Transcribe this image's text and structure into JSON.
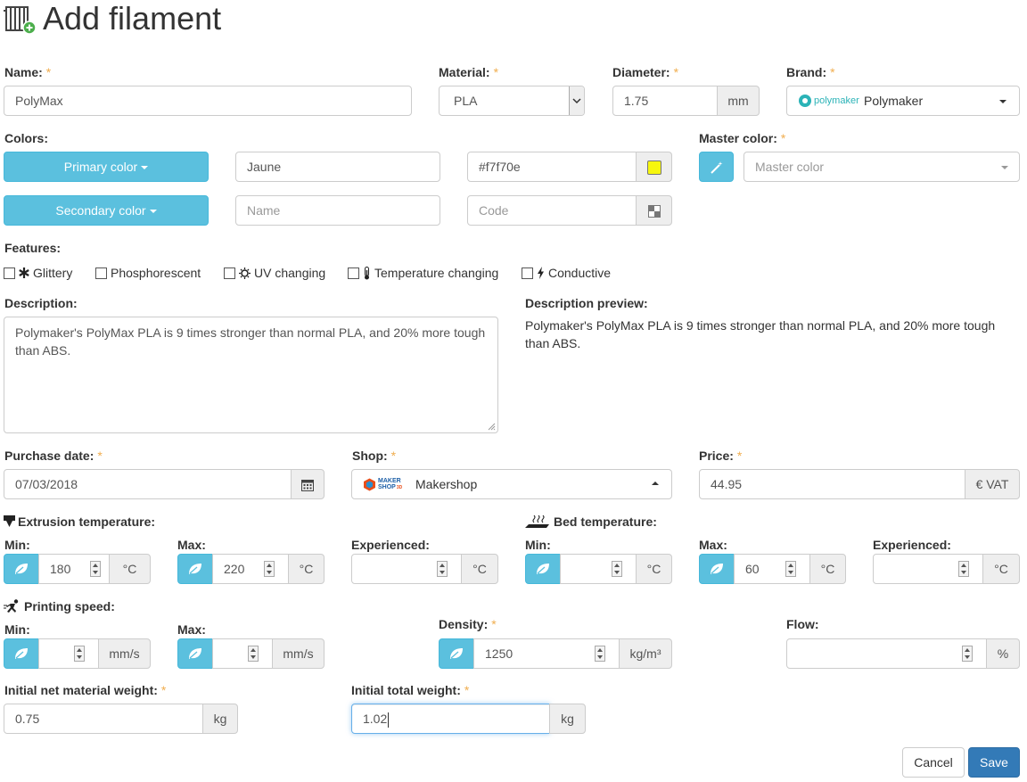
{
  "page": {
    "title": "Add filament"
  },
  "form": {
    "name": {
      "label": "Name:",
      "required": "*",
      "value": "PolyMax"
    },
    "material": {
      "label": "Material:",
      "required": "*",
      "value": "PLA"
    },
    "diameter": {
      "label": "Diameter:",
      "required": "*",
      "value": "1.75",
      "unit": "mm"
    },
    "brand": {
      "label": "Brand:",
      "required": "*",
      "logo_text": "polymaker",
      "value": "Polymaker"
    },
    "colors": {
      "label": "Colors:",
      "primary": {
        "button": "Primary color",
        "name": "Jaune",
        "code": "#f7f70e",
        "swatch": "#f7f70e"
      },
      "secondary": {
        "button": "Secondary color",
        "name_placeholder": "Name",
        "code_placeholder": "Code"
      }
    },
    "master_color": {
      "label": "Master color:",
      "required": "*",
      "placeholder": "Master color"
    },
    "features": {
      "label": "Features:",
      "items": [
        "Glittery",
        "Phosphorescent",
        "UV changing",
        "Temperature changing",
        "Conductive"
      ]
    },
    "description": {
      "label": "Description:",
      "text": "Polymaker's PolyMax PLA is 9 times stronger than normal PLA, and 20% more tough than ABS."
    },
    "description_preview": {
      "label": "Description preview:",
      "text": "Polymaker's PolyMax PLA is 9 times stronger than normal PLA, and 20% more tough than ABS."
    },
    "purchase_date": {
      "label": "Purchase date:",
      "required": "*",
      "value": "07/03/2018"
    },
    "shop": {
      "label": "Shop:",
      "required": "*",
      "logo_line1": "MAKER",
      "logo_line2": "SHOP",
      "logo_sub": "3D",
      "value": "Makershop"
    },
    "price": {
      "label": "Price:",
      "required": "*",
      "value": "44.95",
      "unit": "€ VAT"
    },
    "extrusion": {
      "label": "Extrusion temperature:",
      "min": {
        "label": "Min:",
        "value": "180",
        "unit": "°C"
      },
      "max": {
        "label": "Max:",
        "value": "220",
        "unit": "°C"
      },
      "experienced": {
        "label": "Experienced:",
        "value": "",
        "unit": "°C"
      }
    },
    "bed": {
      "label": "Bed temperature:",
      "min": {
        "label": "Min:",
        "value": "",
        "unit": "°C"
      },
      "max": {
        "label": "Max:",
        "value": "60",
        "unit": "°C"
      },
      "experienced": {
        "label": "Experienced:",
        "value": "",
        "unit": "°C"
      }
    },
    "speed": {
      "label": "Printing speed:",
      "min": {
        "label": "Min:",
        "value": "",
        "unit": "mm/s"
      },
      "max": {
        "label": "Max:",
        "value": "",
        "unit": "mm/s"
      }
    },
    "density": {
      "label": "Density:",
      "required": "*",
      "value": "1250",
      "unit": "kg/m³"
    },
    "flow": {
      "label": "Flow:",
      "value": "",
      "unit": "%"
    },
    "net_weight": {
      "label": "Initial net material weight:",
      "required": "*",
      "value": "0.75",
      "unit": "kg"
    },
    "total_weight": {
      "label": "Initial total weight:",
      "required": "*",
      "value": "1.02",
      "unit": "kg"
    }
  },
  "actions": {
    "cancel": "Cancel",
    "save": "Save"
  },
  "colors": {
    "info": "#5bc0de",
    "primary": "#337ab7",
    "required": "#f0ad4e",
    "brand_logo": "#2bb3b7"
  }
}
